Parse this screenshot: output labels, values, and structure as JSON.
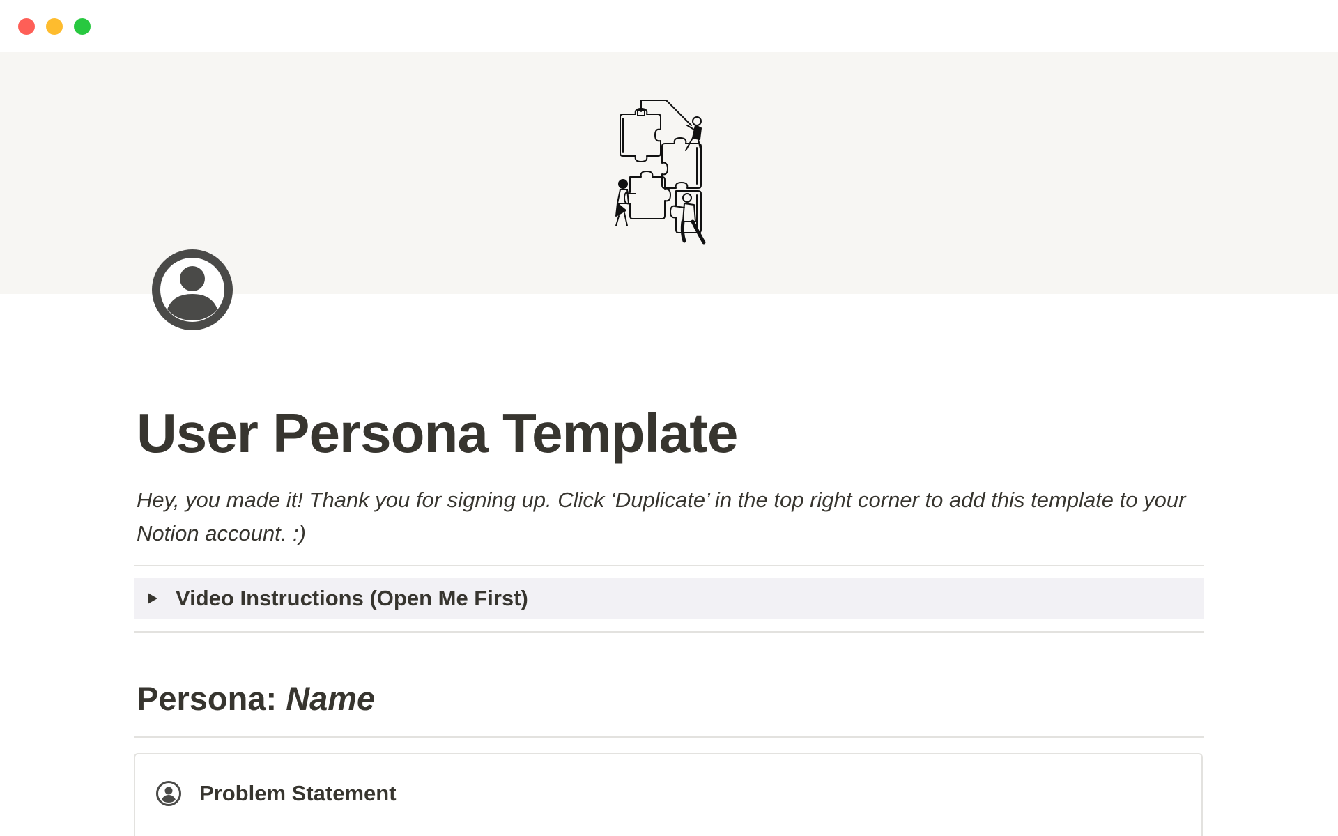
{
  "window": {
    "controls": [
      {
        "name": "close",
        "color": "#fe5f57"
      },
      {
        "name": "minimize",
        "color": "#febc2e"
      },
      {
        "name": "zoom",
        "color": "#28c840"
      }
    ]
  },
  "cover": {
    "background": "#f7f6f3",
    "illustration": "puzzle-people-illustration"
  },
  "page": {
    "icon": "user-circle-icon",
    "title": "User Persona Template",
    "intro": "Hey, you made it! Thank you for signing up. Click ‘Duplicate’ in the top right corner to add this template to your Notion account. :)"
  },
  "toggle": {
    "icon": "triangle-right-icon",
    "label": "Video Instructions (Open Me First)"
  },
  "persona": {
    "prefix": "Persona: ",
    "name": "Name"
  },
  "card": {
    "icon": "user-circle-icon",
    "title": "Problem Statement"
  }
}
